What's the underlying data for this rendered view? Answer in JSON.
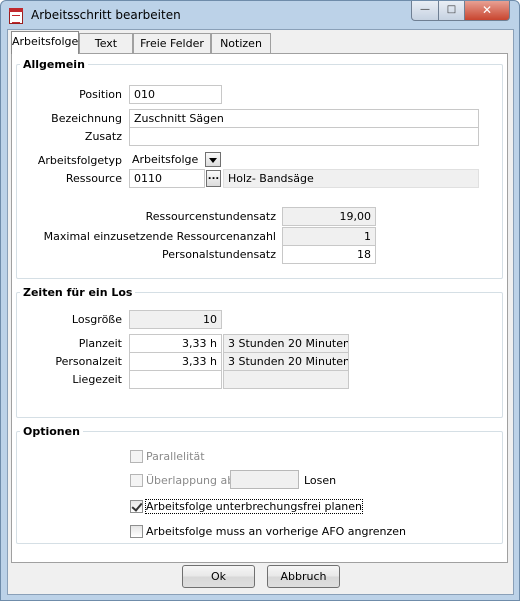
{
  "window": {
    "title": "Arbeitsschritt bearbeiten"
  },
  "tabs": [
    "Arbeitsfolge",
    "Text",
    "Freie Felder",
    "Notizen"
  ],
  "allgemein": {
    "title": "Allgemein",
    "position_label": "Position",
    "position_value": "010",
    "bezeichnung_label": "Bezeichnung",
    "bezeichnung_value": "Zuschnitt Sägen",
    "zusatz_label": "Zusatz",
    "zusatz_value": "",
    "arbeitsfolgetyp_label": "Arbeitsfolgetyp",
    "arbeitsfolgetyp_value": "Arbeitsfolge",
    "ressource_label": "Ressource",
    "ressource_value": "0110",
    "ressource_button": "...",
    "ressource_name": "Holz- Bandsäge",
    "ressourcenstundensatz_label": "Ressourcenstundensatz",
    "ressourcenstundensatz_value": "19,00",
    "maximal_label": "Maximal einzusetzende Ressourcenanzahl",
    "maximal_value": "1",
    "personalstundensatz_label": "Personalstundensatz",
    "personalstundensatz_value": "18"
  },
  "zeiten": {
    "title": "Zeiten für ein Los",
    "losgroesse_label": "Losgröße",
    "losgroesse_value": "10",
    "planzeit_label": "Planzeit",
    "planzeit_value": "3,33 h",
    "planzeit_text": "3 Stunden  20 Minuten",
    "personalzeit_label": "Personalzeit",
    "personalzeit_value": "3,33 h",
    "personalzeit_text": "3 Stunden  20 Minuten",
    "liegezeit_label": "Liegezeit",
    "liegezeit_value": "",
    "liegezeit_text": ""
  },
  "optionen": {
    "title": "Optionen",
    "parallelitaet": {
      "label": "Parallelität",
      "checked": false,
      "disabled": true
    },
    "ueberlappung": {
      "label": "Überlappung ab",
      "value": "",
      "suffix": "Losen",
      "checked": false,
      "disabled": true
    },
    "unterbrechungsfrei": {
      "label": "Arbeitsfolge unterbrechungsfrei planen",
      "checked": true
    },
    "angrenzen": {
      "label": "Arbeitsfolge muss an vorherige AFO angrenzen",
      "checked": false
    }
  },
  "buttons": {
    "ok": "Ok",
    "cancel": "Abbruch"
  },
  "controls": {
    "minimize": "—",
    "maximize": "□",
    "close": "✕"
  }
}
